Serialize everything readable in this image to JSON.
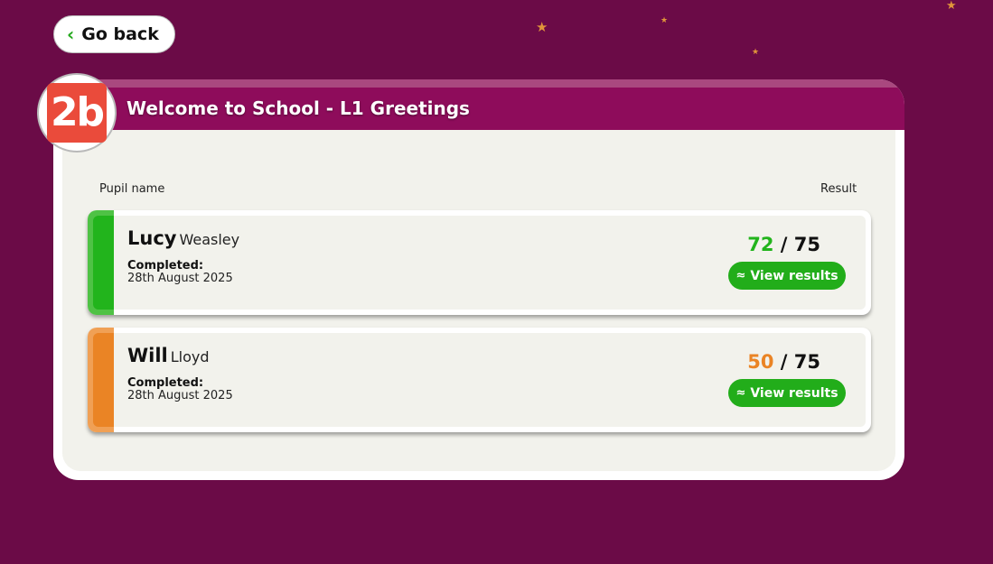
{
  "nav": {
    "back_label": "Go back",
    "back_icon": "chevron-left-icon"
  },
  "panel": {
    "badge": "2b",
    "title": "Welcome to School - L1 Greetings"
  },
  "table": {
    "col_name": "Pupil name",
    "col_result": "Result"
  },
  "pupils": [
    {
      "first": "Lucy",
      "last": "Weasley",
      "completed_label": "Completed:",
      "completed_date": "28th August 2025",
      "score": "72",
      "total": "/ 75",
      "status_color": "#22b41c",
      "stripe_outer": "#4fc245",
      "button": "View results"
    },
    {
      "first": "Will",
      "last": "Lloyd",
      "completed_label": "Completed:",
      "completed_date": "28th August 2025",
      "score": "50",
      "total": "/ 75",
      "status_color": "#ea8425",
      "stripe_outer": "#f0a055",
      "button": "View results"
    }
  ],
  "colors": {
    "background": "#6b0b47",
    "header": "#8e0c5b",
    "accent_green": "#22ad1a",
    "badge_red": "#ea4b3b"
  }
}
